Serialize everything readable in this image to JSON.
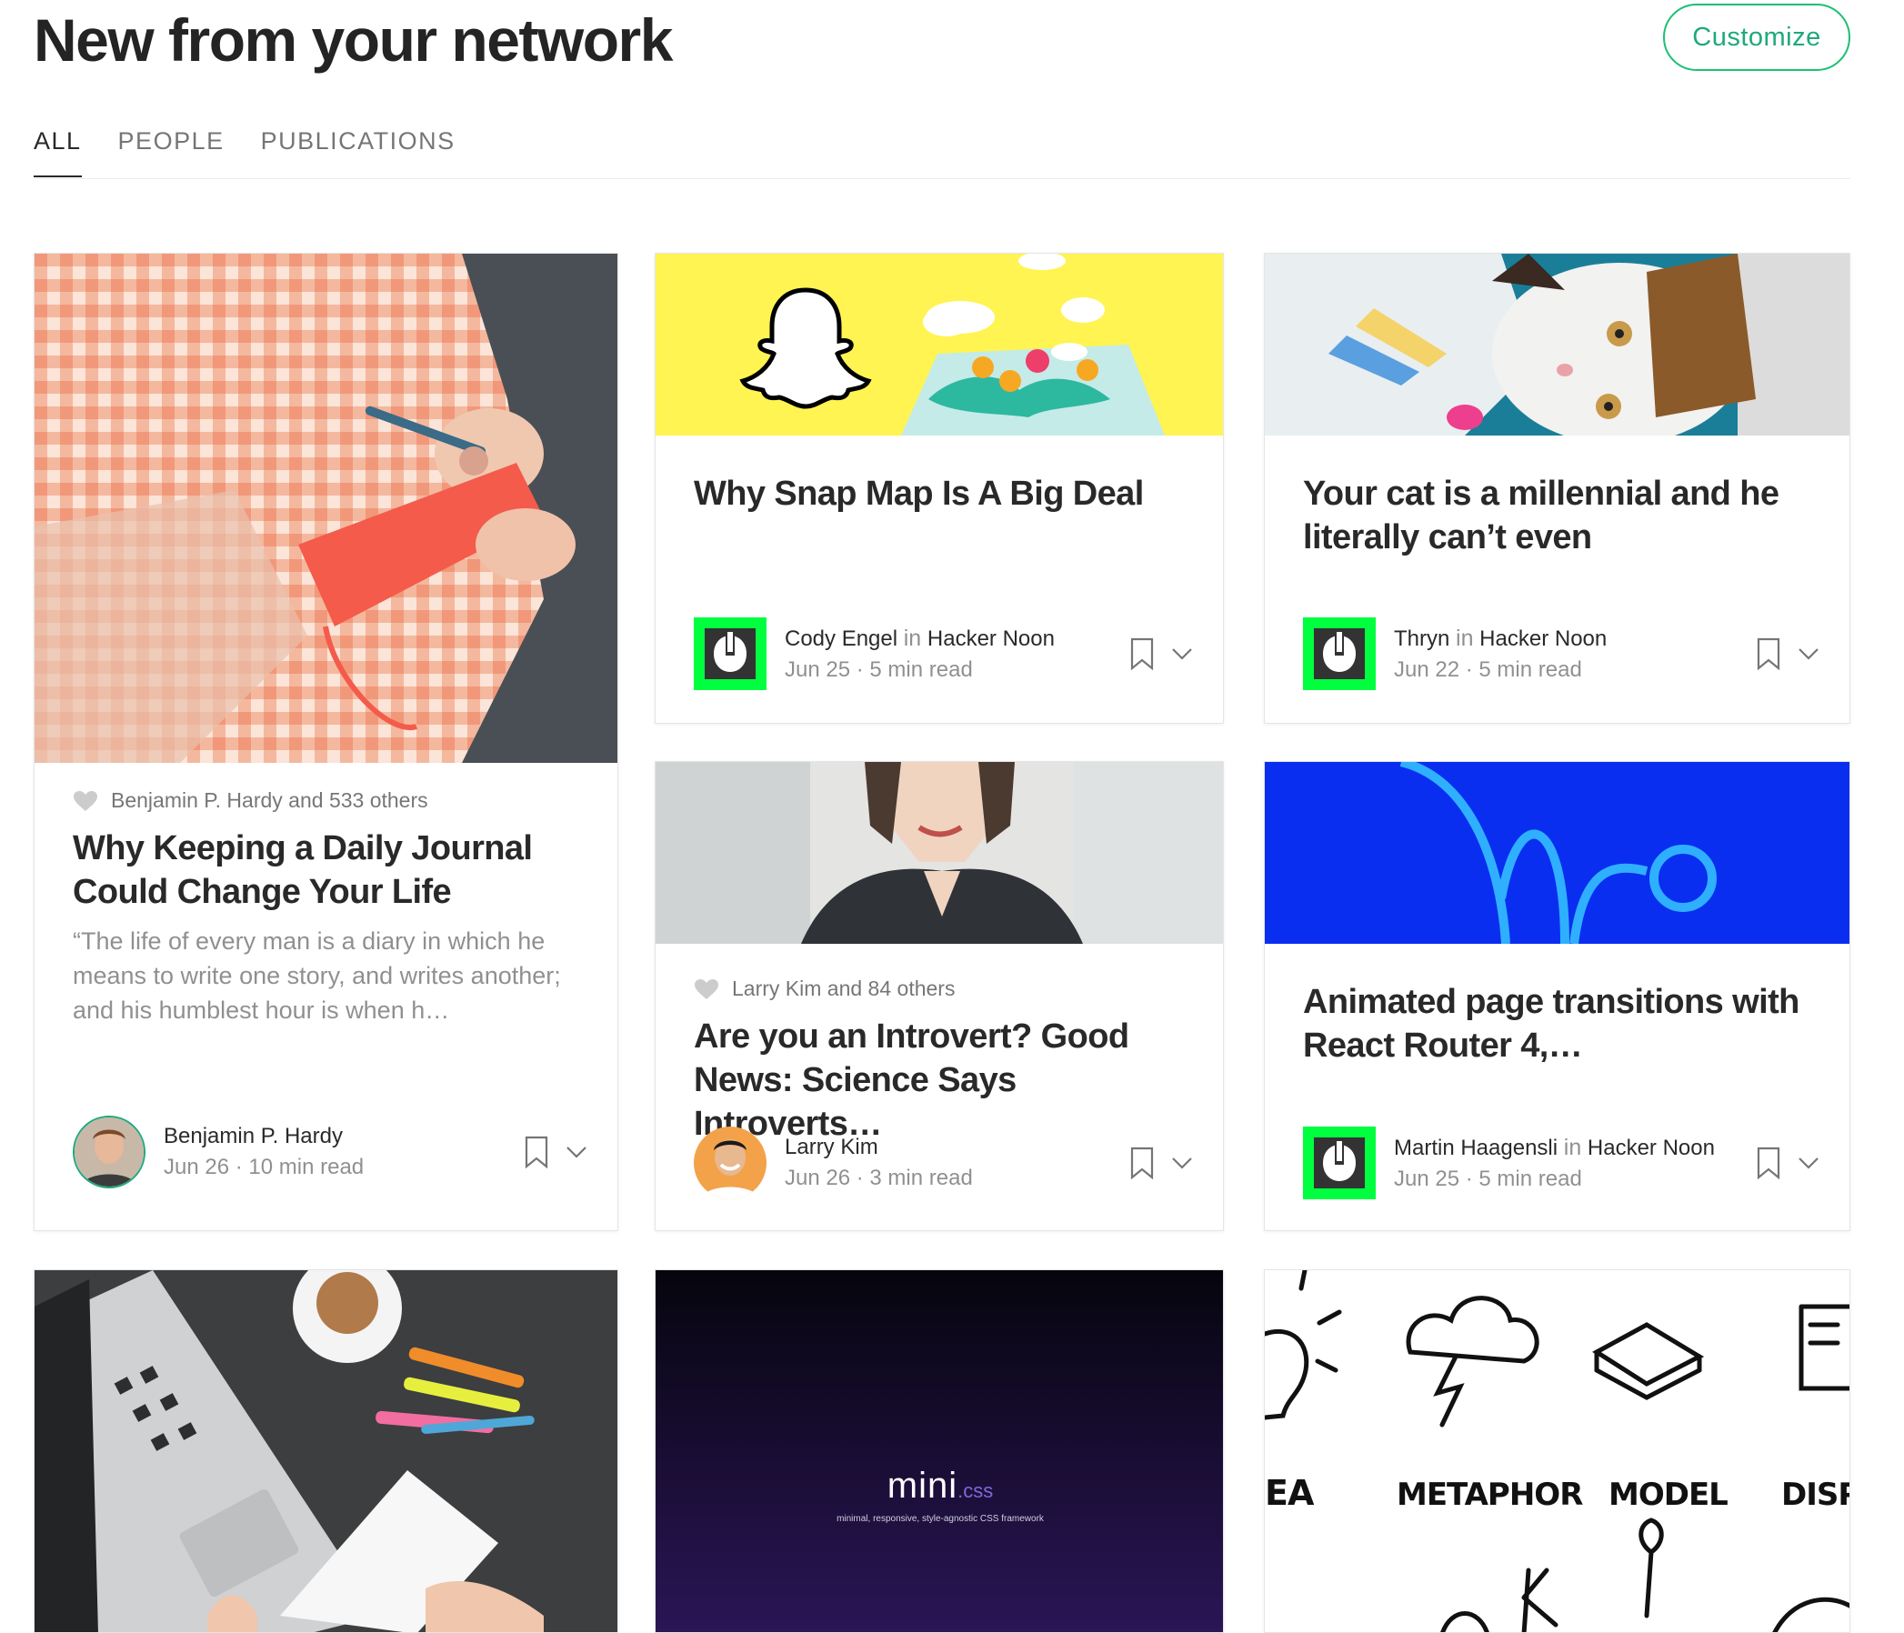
{
  "header": {
    "title": "New from your network",
    "customize_label": "Customize"
  },
  "tabs": [
    {
      "label": "ALL",
      "active": true
    },
    {
      "label": "PEOPLE",
      "active": false
    },
    {
      "label": "PUBLICATIONS",
      "active": false
    }
  ],
  "colors": {
    "accent": "#1ea97c",
    "publication_logo_green": "#00ff3f",
    "snap_yellow": "#fff451",
    "blue_header": "#0a2ef0"
  },
  "cards": [
    {
      "recommended_by": "Benjamin P. Hardy and 533 others",
      "title": "Why Keeping a Daily Journal Could Change Your Life",
      "snippet": "“The life of every man is a diary in which he means to write one story, and writes another; and his humblest hour is when h…",
      "author": "Benjamin P. Hardy",
      "publication": "",
      "date": "Jun 26",
      "read_time": "10 min read",
      "image": "woman-writing-journal"
    },
    {
      "title": "Why Snap Map Is A Big Deal",
      "author": "Cody Engel",
      "in_word": "in",
      "publication": "Hacker Noon",
      "date": "Jun 25",
      "read_time": "5 min read",
      "image": "snapchat-ghost-map"
    },
    {
      "title": "Your cat is a millennial and he literally can’t even",
      "author": "Thryn",
      "in_word": "in",
      "publication": "Hacker Noon",
      "date": "Jun 22",
      "read_time": "5 min read",
      "image": "cat-close-up"
    },
    {
      "recommended_by": "Larry Kim and 84 others",
      "title": "Are you an Introvert? Good News: Science Says Introverts…",
      "author": "Larry Kim",
      "publication": "",
      "date": "Jun 26",
      "read_time": "3 min read",
      "image": "smiling-woman"
    },
    {
      "title": "Animated page transitions with React Router 4,…",
      "author": "Martin Haagensli",
      "in_word": "in",
      "publication": "Hacker Noon",
      "date": "Jun 25",
      "read_time": "5 min read",
      "image": "blue-scribble"
    },
    {
      "image": "laptop-desk"
    },
    {
      "image": "mini-css-banner",
      "banner_logo": "mini",
      "banner_logo_suffix": ".css",
      "banner_tagline": "minimal, responsive, style-agnostic CSS framework"
    },
    {
      "image": "sketch-icons",
      "sketch_words": [
        "EA",
        "METAPHOR",
        "MODEL",
        "DISP"
      ]
    }
  ],
  "dot_separator": "·"
}
